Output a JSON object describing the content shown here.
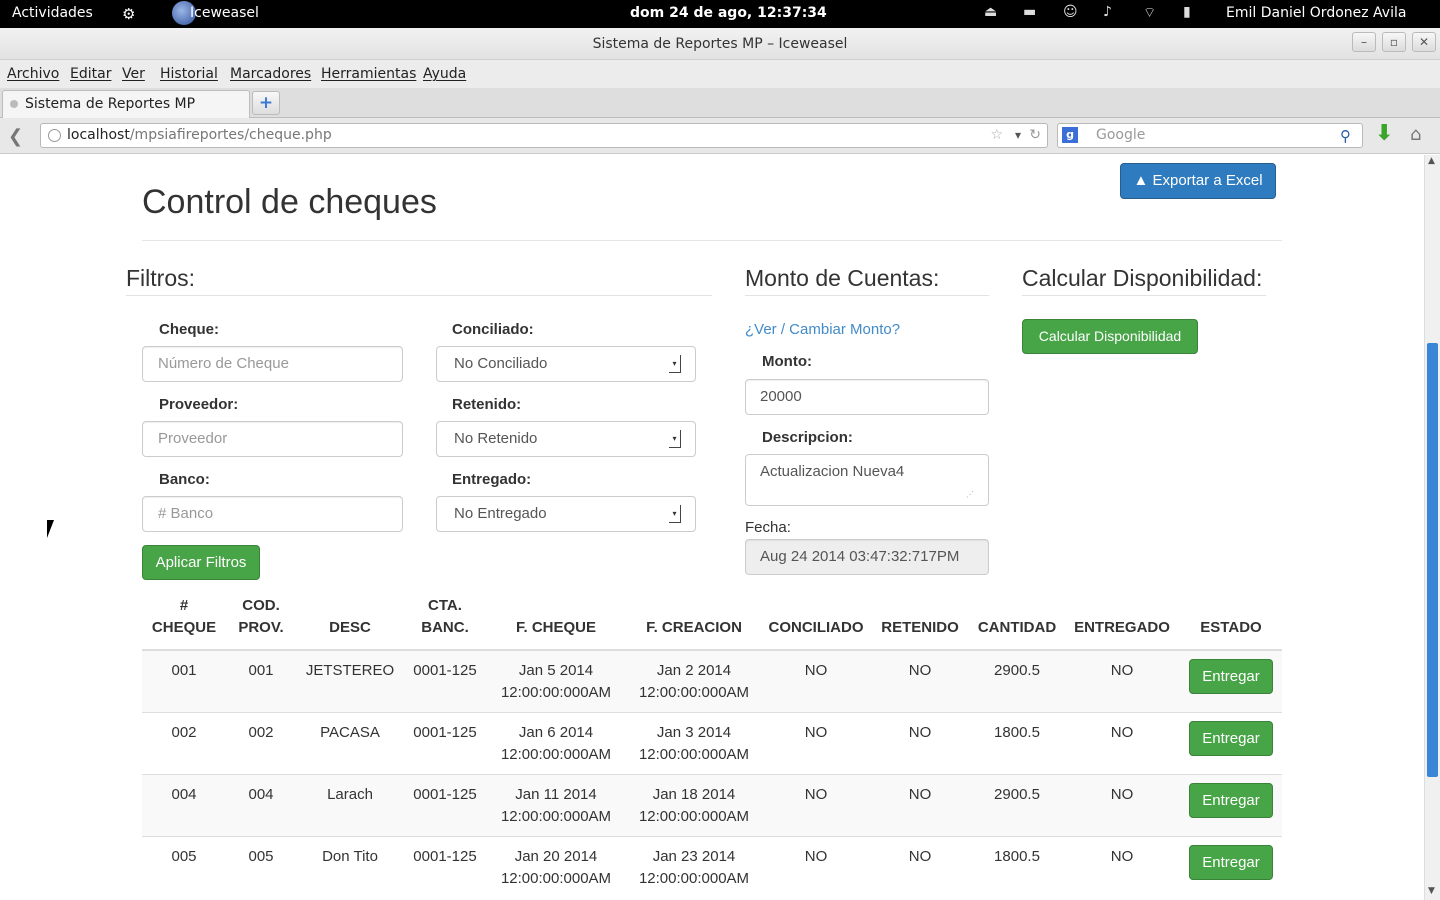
{
  "topbar": {
    "activities": "Actividades",
    "app_name": "Iceweasel",
    "clock": "dom 24 de ago, 12:37:34",
    "user": "Emil Daniel Ordonez Avila"
  },
  "window": {
    "title": "Sistema de Reportes MP – Iceweasel"
  },
  "menu": [
    "Archivo",
    "Editar",
    "Ver",
    "Historial",
    "Marcadores",
    "Herramientas",
    "Ayuda"
  ],
  "tab": {
    "title": "Sistema de Reportes MP"
  },
  "nav": {
    "url_host": "localhost",
    "url_path": "/mpsiafireportes/cheque.php",
    "search_placeholder": "Google"
  },
  "page": {
    "title": "Control de cheques",
    "export_button": "Exportar a Excel",
    "filters": {
      "heading": "Filtros:",
      "cheque_label": "Cheque:",
      "cheque_placeholder": "Número de Cheque",
      "proveedor_label": "Proveedor:",
      "proveedor_placeholder": "Proveedor",
      "banco_label": "Banco:",
      "banco_placeholder": "# Banco",
      "conciliado_label": "Conciliado:",
      "conciliado_value": "No Conciliado",
      "retenido_label": "Retenido:",
      "retenido_value": "No Retenido",
      "entregado_label": "Entregado:",
      "entregado_value": "No Entregado",
      "apply_button": "Aplicar Filtros"
    },
    "monto": {
      "heading": "Monto de Cuentas:",
      "link": "¿Ver / Cambiar Monto?",
      "monto_label": "Monto:",
      "monto_value": "20000",
      "descripcion_label": "Descripcion:",
      "descripcion_value": "Actualizacion Nueva4",
      "fecha_label": "Fecha:",
      "fecha_value": "Aug 24 2014 03:47:32:717PM"
    },
    "disponibilidad": {
      "heading": "Calcular Disponibilidad:",
      "button": "Calcular Disponibilidad"
    },
    "table": {
      "headers": [
        [
          "#",
          "CHEQUE"
        ],
        [
          "COD.",
          "PROV."
        ],
        [
          "DESC"
        ],
        [
          "CTA.",
          "BANC."
        ],
        [
          "F. CHEQUE"
        ],
        [
          "F. CREACION"
        ],
        [
          "CONCILIADO"
        ],
        [
          "RETENIDO"
        ],
        [
          "CANTIDAD"
        ],
        [
          "ENTREGADO"
        ],
        [
          "ESTADO"
        ]
      ],
      "action_label": "Entregar",
      "rows": [
        {
          "cheque": "001",
          "prov": "001",
          "desc": "JETSTEREO",
          "cta": "0001-125",
          "f_cheque": [
            "Jan 5 2014",
            "12:00:00:000AM"
          ],
          "f_creacion": [
            "Jan 2 2014",
            "12:00:00:000AM"
          ],
          "conciliado": "NO",
          "retenido": "NO",
          "cantidad": "2900.5",
          "entregado": "NO"
        },
        {
          "cheque": "002",
          "prov": "002",
          "desc": "PACASA",
          "cta": "0001-125",
          "f_cheque": [
            "Jan 6 2014",
            "12:00:00:000AM"
          ],
          "f_creacion": [
            "Jan 3 2014",
            "12:00:00:000AM"
          ],
          "conciliado": "NO",
          "retenido": "NO",
          "cantidad": "1800.5",
          "entregado": "NO"
        },
        {
          "cheque": "004",
          "prov": "004",
          "desc": "Larach",
          "cta": "0001-125",
          "f_cheque": [
            "Jan 11 2014",
            "12:00:00:000AM"
          ],
          "f_creacion": [
            "Jan 18 2014",
            "12:00:00:000AM"
          ],
          "conciliado": "NO",
          "retenido": "NO",
          "cantidad": "2900.5",
          "entregado": "NO"
        },
        {
          "cheque": "005",
          "prov": "005",
          "desc": "Don Tito",
          "cta": "0001-125",
          "f_cheque": [
            "Jan 20 2014",
            "12:00:00:000AM"
          ],
          "f_creacion": [
            "Jan 23 2014",
            "12:00:00:000AM"
          ],
          "conciliado": "NO",
          "retenido": "NO",
          "cantidad": "1800.5",
          "entregado": "NO"
        }
      ]
    }
  }
}
